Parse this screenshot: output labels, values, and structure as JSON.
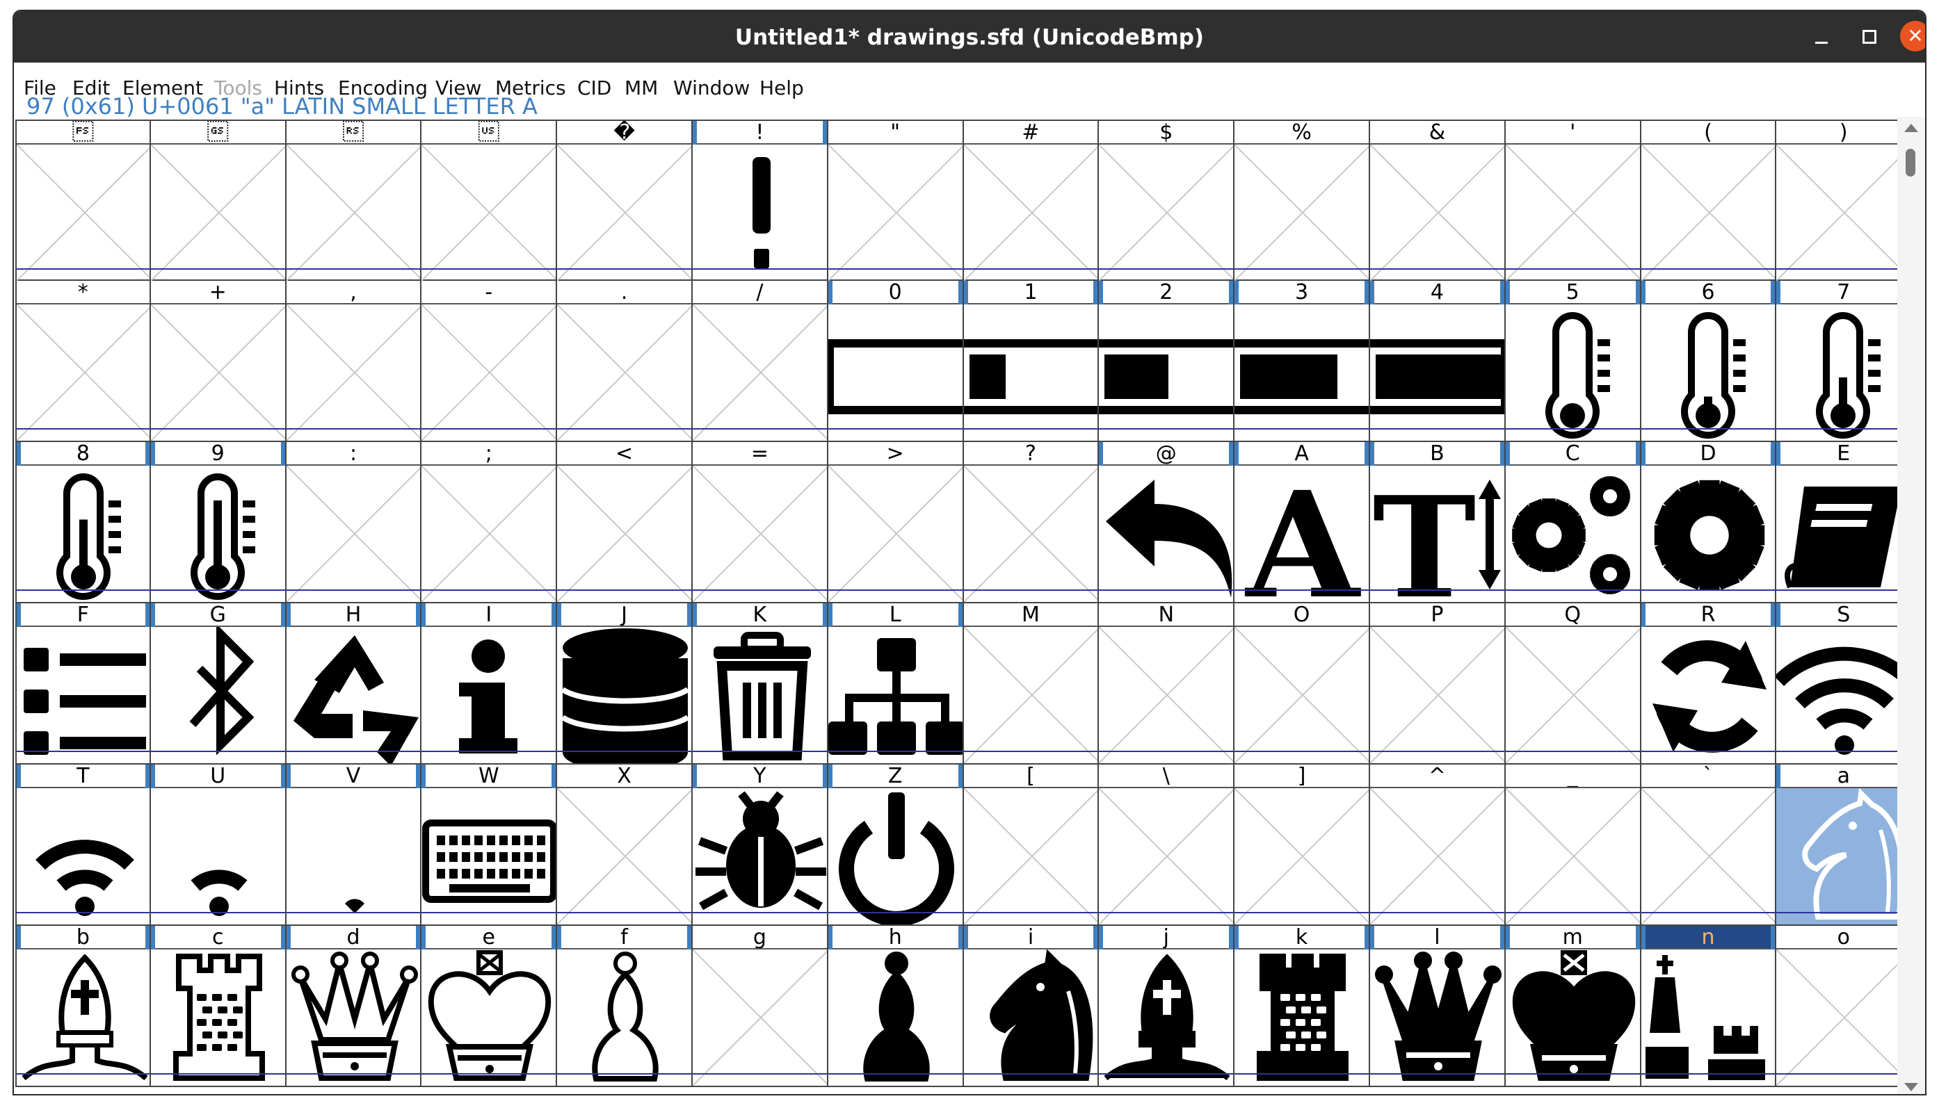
{
  "window": {
    "title": "Untitled1*  drawings.sfd (UnicodeBmp)",
    "close_glyph": "✕"
  },
  "menu": [
    "File",
    "Edit",
    "Element",
    "Tools",
    "Hints",
    "Encoding",
    "View",
    "Metrics",
    "CID",
    "MM",
    "Window",
    "Help"
  ],
  "menu_disabled": [
    "Tools"
  ],
  "info_line": "97 (0x61) U+0061 \"a\" LATIN SMALL LETTER A",
  "selected_char": "a",
  "highlighted_label": "n",
  "cells": [
    {
      "label": "\u001c",
      "glyph": "empty"
    },
    {
      "label": "\u001d",
      "glyph": "empty"
    },
    {
      "label": "\u001e",
      "glyph": "empty"
    },
    {
      "label": "\u001f",
      "glyph": "empty"
    },
    {
      "label": "�",
      "glyph": "empty"
    },
    {
      "label": "!",
      "glyph": "exclamation-icon"
    },
    {
      "label": "\"",
      "glyph": "empty"
    },
    {
      "label": "#",
      "glyph": "empty"
    },
    {
      "label": "$",
      "glyph": "empty"
    },
    {
      "label": "%",
      "glyph": "empty"
    },
    {
      "label": "&",
      "glyph": "empty"
    },
    {
      "label": "'",
      "glyph": "empty"
    },
    {
      "label": "(",
      "glyph": "empty"
    },
    {
      "label": ")",
      "glyph": "empty"
    },
    {
      "label": "*",
      "glyph": "empty"
    },
    {
      "label": "+",
      "glyph": "empty"
    },
    {
      "label": ",",
      "glyph": "empty"
    },
    {
      "label": "-",
      "glyph": "empty"
    },
    {
      "label": ".",
      "glyph": "empty"
    },
    {
      "label": "/",
      "glyph": "empty"
    },
    {
      "label": "0",
      "glyph": "battery-empty-icon"
    },
    {
      "label": "1",
      "glyph": "battery-quarter-icon"
    },
    {
      "label": "2",
      "glyph": "battery-half-icon"
    },
    {
      "label": "3",
      "glyph": "battery-three-quarter-icon"
    },
    {
      "label": "4",
      "glyph": "battery-full-icon"
    },
    {
      "label": "5",
      "glyph": "thermometer-empty-icon"
    },
    {
      "label": "6",
      "glyph": "thermometer-quarter-icon"
    },
    {
      "label": "7",
      "glyph": "thermometer-half-icon"
    },
    {
      "label": "8",
      "glyph": "thermometer-three-quarter-icon"
    },
    {
      "label": "9",
      "glyph": "thermometer-full-icon"
    },
    {
      "label": ":",
      "glyph": "empty"
    },
    {
      "label": ";",
      "glyph": "empty"
    },
    {
      "label": "<",
      "glyph": "empty"
    },
    {
      "label": "=",
      "glyph": "empty"
    },
    {
      "label": ">",
      "glyph": "empty"
    },
    {
      "label": "?",
      "glyph": "empty"
    },
    {
      "label": "@",
      "glyph": "reply-arrow-icon"
    },
    {
      "label": "A",
      "glyph": "font-icon"
    },
    {
      "label": "B",
      "glyph": "text-height-icon"
    },
    {
      "label": "C",
      "glyph": "gears-icon"
    },
    {
      "label": "D",
      "glyph": "gear-icon"
    },
    {
      "label": "E",
      "glyph": "book-icon"
    },
    {
      "label": "F",
      "glyph": "list-icon"
    },
    {
      "label": "G",
      "glyph": "bluetooth-icon"
    },
    {
      "label": "H",
      "glyph": "recycle-icon"
    },
    {
      "label": "I",
      "glyph": "info-icon"
    },
    {
      "label": "J",
      "glyph": "database-icon"
    },
    {
      "label": "K",
      "glyph": "trash-icon"
    },
    {
      "label": "L",
      "glyph": "sitemap-icon"
    },
    {
      "label": "M",
      "glyph": "empty"
    },
    {
      "label": "N",
      "glyph": "empty"
    },
    {
      "label": "O",
      "glyph": "empty"
    },
    {
      "label": "P",
      "glyph": "empty"
    },
    {
      "label": "Q",
      "glyph": "empty"
    },
    {
      "label": "R",
      "glyph": "refresh-icon"
    },
    {
      "label": "S",
      "glyph": "wifi-full-icon"
    },
    {
      "label": "T",
      "glyph": "wifi-medium-icon"
    },
    {
      "label": "U",
      "glyph": "wifi-low-icon"
    },
    {
      "label": "V",
      "glyph": "wifi-dot-icon"
    },
    {
      "label": "W",
      "glyph": "keyboard-icon"
    },
    {
      "label": "X",
      "glyph": "empty"
    },
    {
      "label": "Y",
      "glyph": "bug-icon"
    },
    {
      "label": "Z",
      "glyph": "power-icon"
    },
    {
      "label": "[",
      "glyph": "empty"
    },
    {
      "label": "\\",
      "glyph": "empty"
    },
    {
      "label": "]",
      "glyph": "empty"
    },
    {
      "label": "^",
      "glyph": "empty"
    },
    {
      "label": "_",
      "glyph": "empty"
    },
    {
      "label": "`",
      "glyph": "empty"
    },
    {
      "label": "a",
      "glyph": "chess-knight-outline-icon"
    },
    {
      "label": "b",
      "glyph": "chess-bishop-outline-icon"
    },
    {
      "label": "c",
      "glyph": "chess-rook-outline-icon"
    },
    {
      "label": "d",
      "glyph": "chess-queen-outline-icon"
    },
    {
      "label": "e",
      "glyph": "chess-king-outline-icon"
    },
    {
      "label": "f",
      "glyph": "chess-pawn-outline-icon"
    },
    {
      "label": "g",
      "glyph": "empty"
    },
    {
      "label": "h",
      "glyph": "chess-pawn-icon"
    },
    {
      "label": "i",
      "glyph": "chess-knight-icon"
    },
    {
      "label": "j",
      "glyph": "chess-bishop-icon"
    },
    {
      "label": "k",
      "glyph": "chess-rook-icon"
    },
    {
      "label": "l",
      "glyph": "chess-queen-icon"
    },
    {
      "label": "m",
      "glyph": "chess-king-icon"
    },
    {
      "label": "n",
      "glyph": "chess-pieces-icon"
    },
    {
      "label": "o",
      "glyph": "empty"
    }
  ]
}
